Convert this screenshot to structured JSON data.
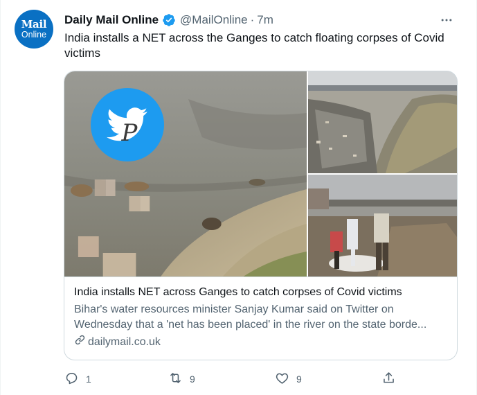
{
  "author": {
    "avatar_line1": "Mail",
    "avatar_line2": "Online",
    "name": "Daily Mail Online",
    "handle": "@MailOnline",
    "separator": "·",
    "time": "7m",
    "verified": true
  },
  "tweet": {
    "text": "India installs a NET across the Ganges to catch floating corpses of Covid victims"
  },
  "card": {
    "title": "India installs NET across Ganges to catch corpses of Covid victims",
    "description": "Bihar's water resources minister Sanjay Kumar said on Twitter on Wednesday that a 'net has been placed' in the river on the state borde...",
    "domain": "dailymail.co.uk",
    "watermark_letter": "P"
  },
  "actions": {
    "reply_count": "1",
    "retweet_count": "9",
    "like_count": "9"
  },
  "colors": {
    "brand_blue": "#0a70c3",
    "verified_blue": "#1d9bf0",
    "text_primary": "#0f1419",
    "text_secondary": "#536471",
    "border": "#cfd9de"
  },
  "icons": {
    "verified": "verified-badge-icon",
    "more": "more-horizontal-icon",
    "link": "link-icon",
    "reply": "reply-icon",
    "retweet": "retweet-icon",
    "like": "like-icon",
    "share": "share-icon",
    "watermark": "twitter-bird-watermark-icon"
  }
}
